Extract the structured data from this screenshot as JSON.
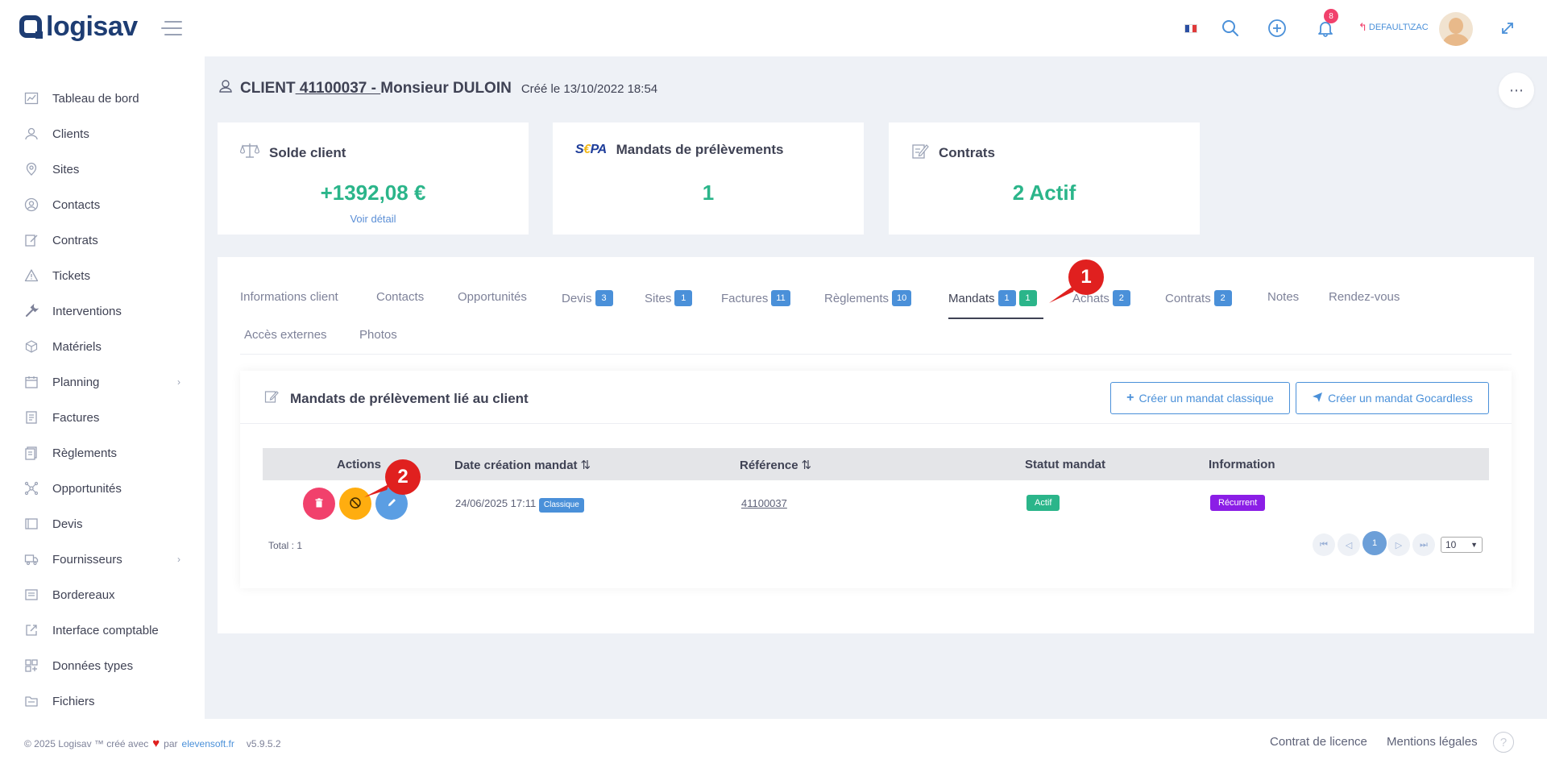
{
  "header": {
    "logo_text": "logisav",
    "notifications_count": "8",
    "user_label": "DEFAULT\\ZAC"
  },
  "sidebar": {
    "items": [
      {
        "label": "Tableau de bord",
        "icon": "dashboard-icon"
      },
      {
        "label": "Clients",
        "icon": "clients-icon"
      },
      {
        "label": "Sites",
        "icon": "location-icon"
      },
      {
        "label": "Contacts",
        "icon": "contacts-icon"
      },
      {
        "label": "Contrats",
        "icon": "contract-icon"
      },
      {
        "label": "Tickets",
        "icon": "warning-icon"
      },
      {
        "label": "Interventions",
        "icon": "wrench-icon"
      },
      {
        "label": "Matériels",
        "icon": "box-icon"
      },
      {
        "label": "Planning",
        "icon": "calendar-icon",
        "has_submenu": true
      },
      {
        "label": "Factures",
        "icon": "invoice-icon"
      },
      {
        "label": "Règlements",
        "icon": "payments-icon"
      },
      {
        "label": "Opportunités",
        "icon": "network-icon"
      },
      {
        "label": "Devis",
        "icon": "quote-icon"
      },
      {
        "label": "Fournisseurs",
        "icon": "truck-icon",
        "has_submenu": true
      },
      {
        "label": "Bordereaux",
        "icon": "slip-icon"
      },
      {
        "label": "Interface comptable",
        "icon": "external-link-icon"
      },
      {
        "label": "Données types",
        "icon": "grid-add-icon"
      },
      {
        "label": "Fichiers",
        "icon": "files-icon"
      }
    ]
  },
  "page": {
    "title_prefix": "CLIENT",
    "client_number": " 41100037 - ",
    "client_name": "Monsieur DULOIN",
    "created": "Créé le 13/10/2022 18:54"
  },
  "cards": {
    "balance": {
      "title": "Solde client",
      "value": "+1392,08 €",
      "link": "Voir détail"
    },
    "mandates": {
      "logo": "SEPA",
      "title": "Mandats de prélèvements",
      "value": "1"
    },
    "contracts": {
      "title": "Contrats",
      "value": "2 Actif"
    }
  },
  "tabs": [
    {
      "label": "Informations client"
    },
    {
      "label": "Contacts"
    },
    {
      "label": "Opportunités"
    },
    {
      "label": "Devis",
      "badge": "3"
    },
    {
      "label": "Sites",
      "badge": "1"
    },
    {
      "label": "Factures",
      "badge": "11"
    },
    {
      "label": "Règlements",
      "badge": "10"
    },
    {
      "label": "Mandats",
      "badge": "1",
      "badge2": "1",
      "active": true
    },
    {
      "label": "Achats",
      "badge": "2"
    },
    {
      "label": "Contrats",
      "badge": "2"
    },
    {
      "label": "Notes"
    },
    {
      "label": "Rendez-vous"
    },
    {
      "label": "Accès externes"
    },
    {
      "label": "Photos"
    }
  ],
  "mandates_section": {
    "title": "Mandats de prélèvement lié au client",
    "btn_classic": "Créer un mandat classique",
    "btn_gocardless": "Créer un mandat Gocardless",
    "columns": [
      "Actions",
      "Date création mandat",
      "Référence",
      "Statut mandat",
      "Information"
    ],
    "rows": [
      {
        "date": "24/06/2025 17:11",
        "type": "Classique",
        "reference": "41100037",
        "status": "Actif",
        "info": "Récurrent"
      }
    ],
    "total": "Total : 1",
    "current_page": "1",
    "page_size": "10"
  },
  "callouts": [
    "1",
    "2"
  ],
  "colors": {
    "primary": "#4a90d9",
    "success": "#2bb58a",
    "danger": "#f1416c",
    "warning": "#ffad0f",
    "purple": "#8b1ee6",
    "callout": "#e0201f"
  },
  "footer": {
    "copyright": "© 2025 Logisav ™ créé avec",
    "by": "par",
    "author": "elevensoft.fr",
    "version": "v5.9.5.2",
    "license": "Contrat de licence",
    "legal": "Mentions légales",
    "help": "?"
  }
}
